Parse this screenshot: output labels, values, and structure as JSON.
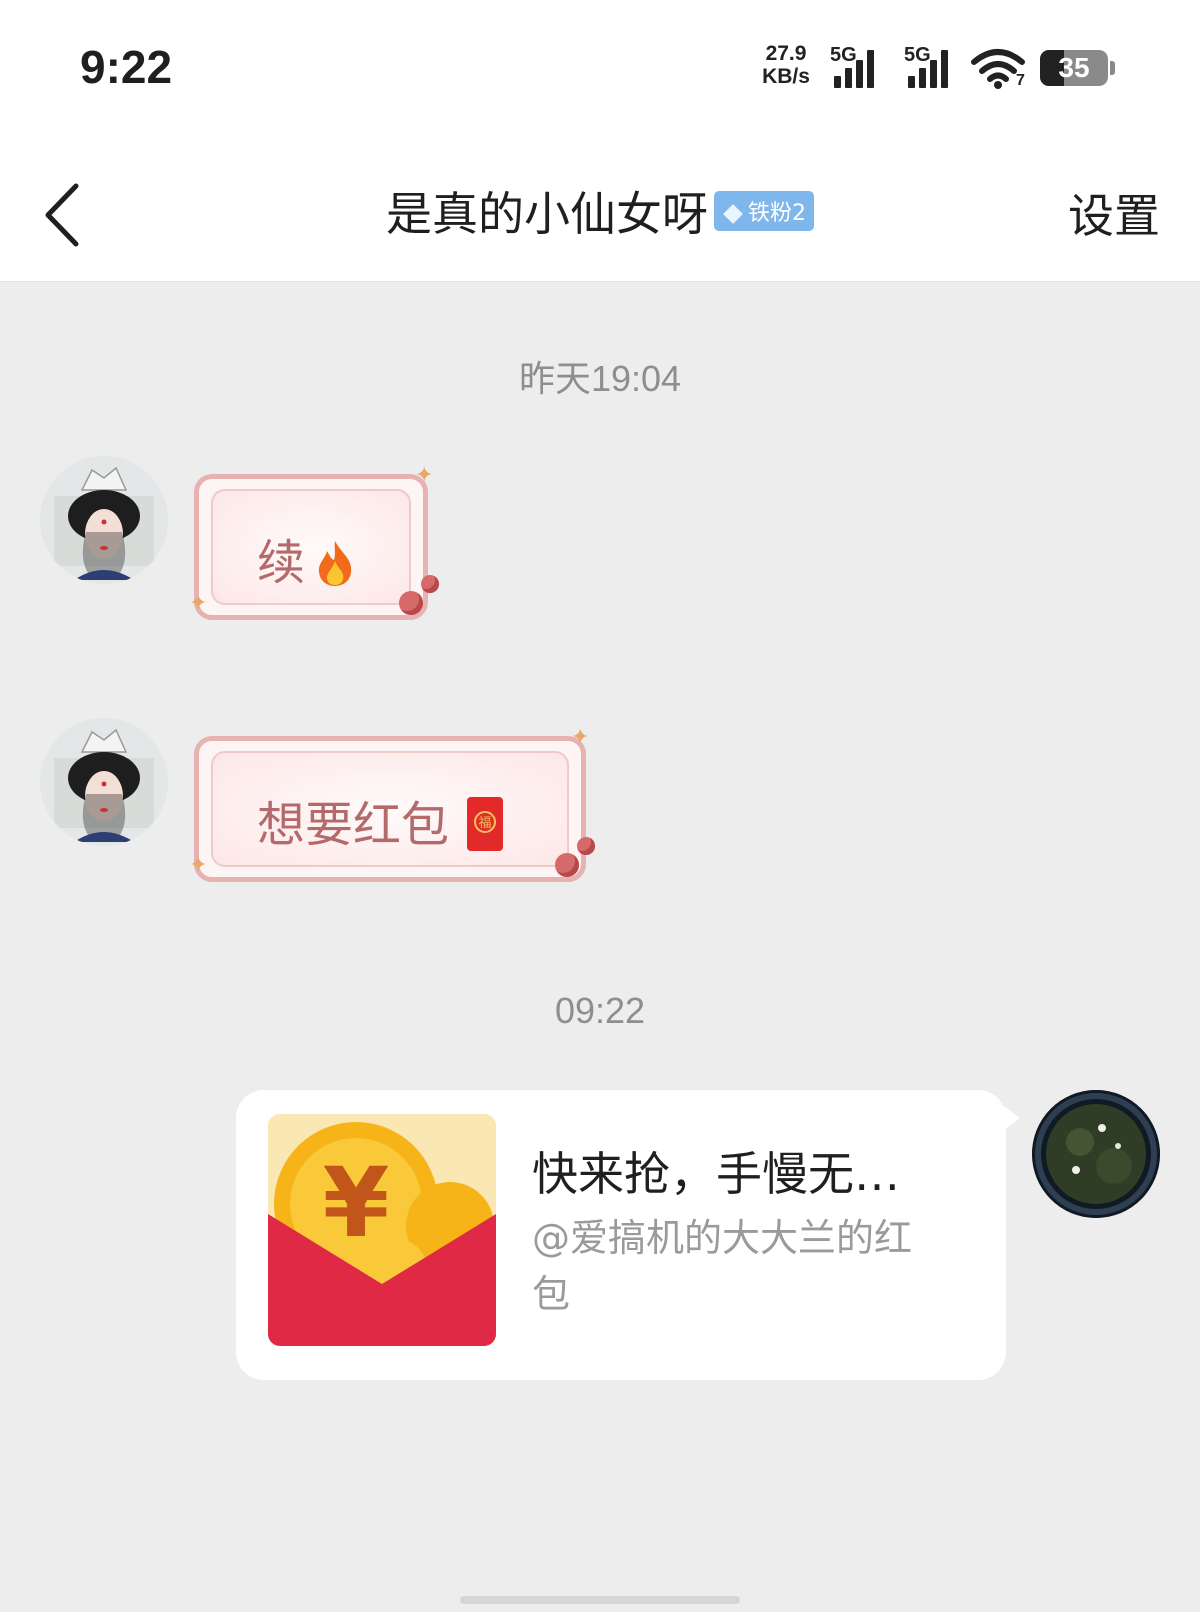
{
  "status_bar": {
    "time": "9:22",
    "net_speed_value": "27.9",
    "net_speed_unit": "KB/s",
    "signal1_label": "5G",
    "signal2_label": "5G",
    "wifi_label": "7",
    "battery_level": "35"
  },
  "nav": {
    "title": "是真的小仙女呀",
    "badge": "铁粉2",
    "settings": "设置"
  },
  "messages": {
    "timestamp1": "昨天19:04",
    "msg1": "续",
    "msg2": "想要红包",
    "redenvelope_char": "福",
    "timestamp2": "09:22",
    "packet_title": "快来抢，手慢无…",
    "packet_sub": "@爱搞机的大大兰的红包"
  },
  "colors": {
    "badge": "#7fb6ec",
    "bubble_border": "#e7b2b2",
    "bubble_text": "#b46a6a",
    "packet_red": "#e02a45",
    "coin_gold": "#f6b418"
  }
}
